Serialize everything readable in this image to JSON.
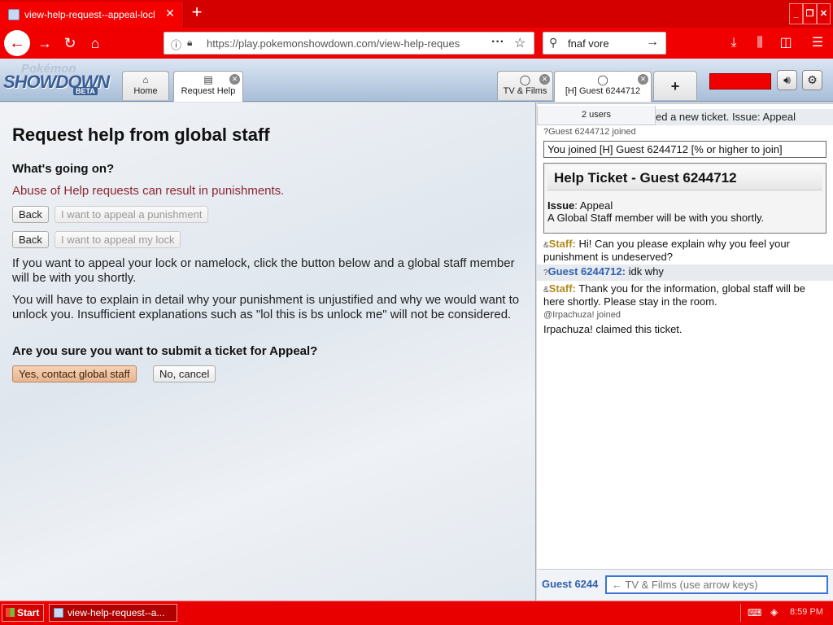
{
  "browser": {
    "tab_title": "view-help-request--appeal-lock-c",
    "url": "https://play.pokemonshowdown.com/view-help-reques",
    "search_value": "fnaf vore"
  },
  "ps_header": {
    "logo_top": "Pokémon",
    "logo_main": "SHOWDOWN",
    "logo_beta": "BETA",
    "tabs": [
      {
        "label": "Home",
        "icon": "home-icon"
      },
      {
        "label": "Request Help",
        "icon": "document-icon"
      },
      {
        "label": "TV & Films",
        "icon": "chat-bubble-icon"
      },
      {
        "label": "[H] Guest 6244712",
        "icon": "chat-bubble-icon"
      }
    ],
    "add_tab": "+"
  },
  "main": {
    "title": "Request help from global staff",
    "question1": "What's going on?",
    "warning": "Abuse of Help requests can result in punishments.",
    "back1": "Back",
    "choice1": "I want to appeal a punishment",
    "back2": "Back",
    "choice2": "I want to appeal my lock",
    "para1": "If you want to appeal your lock or namelock, click the button below and a global staff member will be with you shortly.",
    "para2": "You will have to explain in detail why your punishment is unjustified and why we would want to unlock you. Insufficient explanations such as \"lol this is bs unlock me\" will not be considered.",
    "question2": "Are you sure you want to submit a ticket for Appeal?",
    "confirm": "Yes, contact global staff",
    "cancel": "No, cancel"
  },
  "chat": {
    "user_count": "2 users",
    "ticket_line": "ed a new ticket. Issue: Appeal",
    "join1_sym": "?",
    "join1": "Guest 6244712 joined",
    "notice": "You joined [H] Guest 6244712 [% or higher to join]",
    "ticket_title": "Help Ticket - Guest 6244712",
    "issue_label": "Issue",
    "issue_value": ": Appeal",
    "ticket_note": "A Global Staff member will be with you shortly.",
    "messages": [
      {
        "sym": "&",
        "who": "Staff:",
        "text": " Hi! Can you please explain why you feel your punishment is undeserved?"
      },
      {
        "sym": "?",
        "who": "Guest 6244712:",
        "text": " idk why"
      },
      {
        "sym": "&",
        "who": "Staff:",
        "text": " Thank you for the information, global staff will be here shortly. Please stay in the room."
      }
    ],
    "join2": "@Irpachuza! joined",
    "claim": "Irpachuza! claimed this ticket.",
    "input_name": "Guest 6244",
    "input_placeholder": "← TV & Films (use arrow keys)"
  },
  "taskbar": {
    "start": "Start",
    "item": "view-help-request--a...",
    "clock": "8:59 PM"
  },
  "colors": {
    "firefox_red": "#f00000",
    "staff_name": "#b08a1e",
    "guest_name": "#3060b0",
    "warning_text": "#8b2430"
  }
}
